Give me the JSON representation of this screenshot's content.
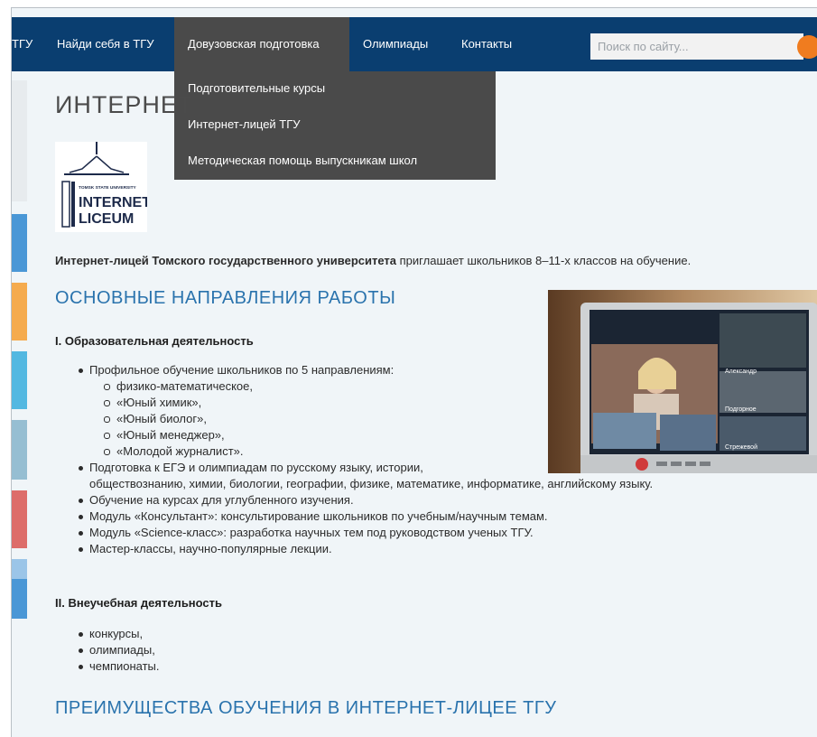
{
  "nav": {
    "items": [
      "ТГУ",
      "Найди себя в ТГУ",
      "Довузовская подготовка",
      "Олимпиады",
      "Контакты"
    ],
    "search_placeholder": "Поиск по сайту..."
  },
  "dropdown": {
    "items": [
      "Подготовительные курсы",
      "Интернет-лицей ТГУ",
      "Методическая помощь выпускникам школ"
    ]
  },
  "page": {
    "title": "ИНТЕРНЕТ",
    "logo_text": [
      "TOMSK STATE UNIVERSITY",
      "INTERNET",
      "LICEUM"
    ],
    "intro_bold": "Интернет-лицей Томского государственного университета",
    "intro_rest": " приглашает школьников 8–11-х классов на обучение."
  },
  "directions": {
    "heading": "ОСНОВНЫЕ НАПРАВЛЕНИЯ РАБОТЫ",
    "section1_title": "I. Образовательная деятельность",
    "profile_item": "Профильное обучение школьников по 5 направлениям:",
    "profile_sub": [
      "физико-математическое,",
      "«Юный химик»,",
      "«Юный биолог»,",
      "«Юный менеджер»,",
      "«Молодой журналист»."
    ],
    "items": [
      "Подготовка к ЕГЭ и олимпиадам по русскому языку, истории,",
      "обществознанию, химии, биологии, географии, физике, математике, информатике, английскому языку.",
      "Обучение на курсах для углубленного изучения.",
      "Модуль «Консультант»: консультирование школьников по учебным/научным темам.",
      "Модуль «Science-класс»: разработка научных тем под руководством ученых ТГУ.",
      "Мастер-классы, научно-популярные лекции."
    ],
    "section2_title": "II. Внеучебная деятельность",
    "extra_items": [
      "конкурсы,",
      "олимпиады,",
      "чемпионаты."
    ]
  },
  "photo": {
    "labels": [
      "Александр",
      "Подгорное",
      "Стрежевой"
    ]
  },
  "advantages": {
    "heading": "ПРЕИМУЩЕСТВА ОБУЧЕНИЯ В ИНТЕРНЕТ-ЛИЦЕЕ ТГУ"
  },
  "colors": {
    "nav_bg": "#0a3e70",
    "dropdown_bg": "#4a4a4a",
    "heading": "#2a73ad",
    "search_button": "#f07c1f",
    "page_bg": "#f0f5f8"
  },
  "icons": {
    "search_button": "search-icon"
  }
}
